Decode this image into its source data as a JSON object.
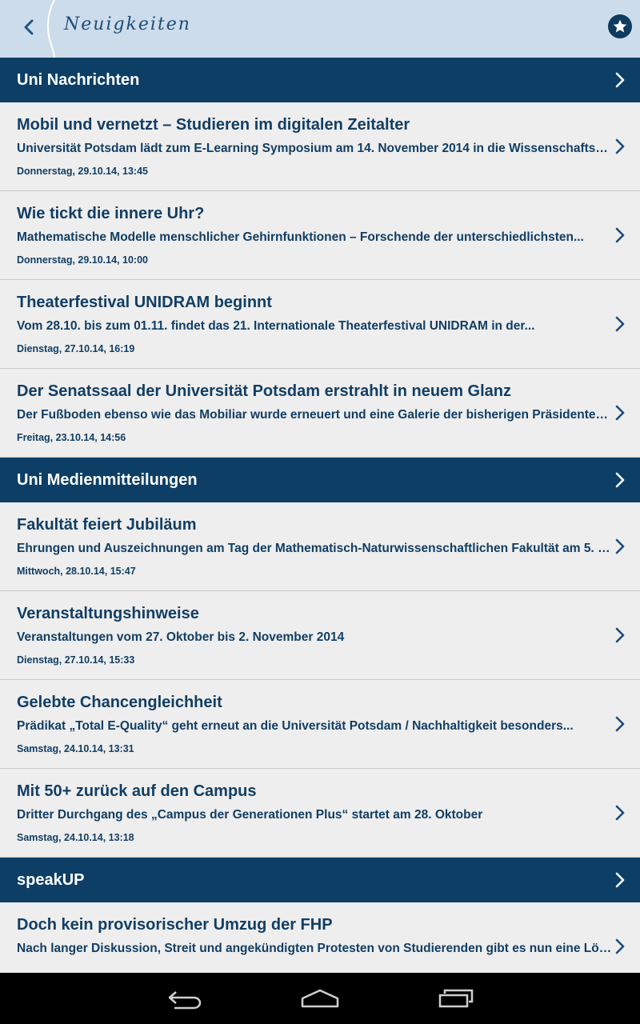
{
  "header": {
    "title": "Neuigkeiten",
    "back_icon": "chevron-left-icon",
    "favorite_icon": "star-icon"
  },
  "colors": {
    "topbar": "#cddceb",
    "section": "#0d3f66",
    "text": "#123e64",
    "background": "#eeeeee"
  },
  "sections": [
    {
      "title": "Uni Nachrichten",
      "items": [
        {
          "title": "Mobil und vernetzt – Studieren im digitalen Zeitalter",
          "subtitle": "Universität Potsdam lädt zum E-Learning Symposium am 14. November 2014 in die Wissenschaftset...",
          "date": "Donnerstag, 29.10.14, 13:45"
        },
        {
          "title": "Wie tickt die innere Uhr?",
          "subtitle": "Mathematische Modelle menschlicher Gehirnfunktionen – Forschende der unterschiedlichsten...",
          "date": "Donnerstag, 29.10.14, 10:00"
        },
        {
          "title": "Theaterfestival UNIDRAM beginnt",
          "subtitle": "Vom 28.10. bis zum 01.11. findet das 21. Internationale Theaterfestival UNIDRAM in der...",
          "date": "Dienstag, 27.10.14, 16:19"
        },
        {
          "title": "Der Senatssaal der Universität Potsdam erstrahlt in neuem Glanz",
          "subtitle": "Der Fußboden ebenso wie das Mobiliar wurde erneuert und eine Galerie der bisherigen Präsidenten un...",
          "date": "Freitag, 23.10.14, 14:56"
        }
      ]
    },
    {
      "title": "Uni Medienmitteilungen",
      "items": [
        {
          "title": "Fakultät feiert Jubiläum",
          "subtitle": "Ehrungen und Auszeichnungen am Tag der Mathematisch-Naturwissenschaftlichen Fakultät am 5. N...",
          "date": "Mittwoch, 28.10.14, 15:47"
        },
        {
          "title": "Veranstaltungshinweise",
          "subtitle": "Veranstaltungen vom 27. Oktober bis 2. November 2014",
          "date": "Dienstag, 27.10.14, 15:33"
        },
        {
          "title": "Gelebte Chancengleichheit",
          "subtitle": "Prädikat „Total E-Quality“ geht erneut an die Universität Potsdam / Nachhaltigkeit besonders...",
          "date": "Samstag, 24.10.14, 13:31"
        },
        {
          "title": "Mit 50+ zurück auf den Campus",
          "subtitle": "Dritter Durchgang des „Campus der Generationen Plus“ startet am 28. Oktober",
          "date": "Samstag, 24.10.14, 13:18"
        }
      ]
    },
    {
      "title": "speakUP",
      "items": [
        {
          "title": "Doch kein provisorischer Umzug der FHP",
          "subtitle": "Nach langer Diskussion, Streit und angekündigten Protesten von Studierenden gibt es nun eine Lösun...",
          "date": ""
        }
      ]
    }
  ],
  "navbar": {
    "back_icon": "nav-back-icon",
    "home_icon": "nav-home-icon",
    "recents_icon": "nav-recents-icon"
  }
}
